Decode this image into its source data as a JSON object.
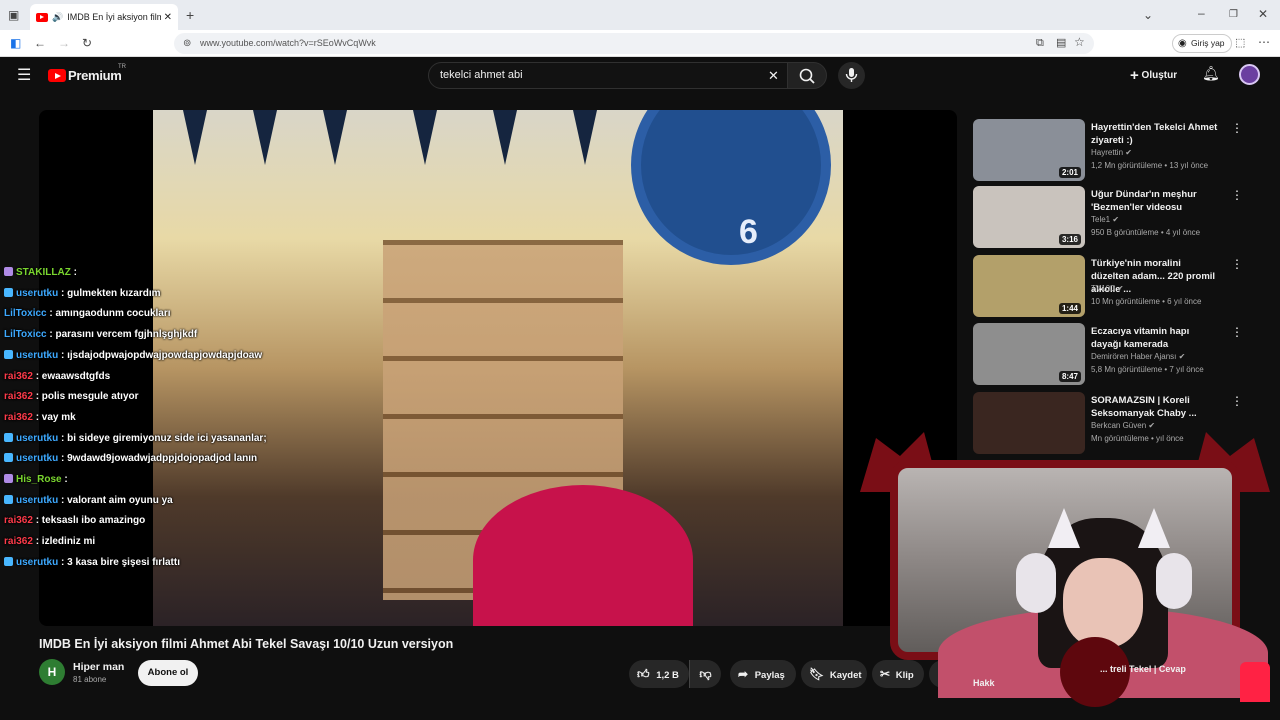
{
  "browser": {
    "tab_title": "IMDB En İyi aksiyon filmi Ah",
    "url": "www.youtube.com/watch?v=rSEoWvCqWvk",
    "signin_label": "Giriş yap"
  },
  "header": {
    "logo_text": "Premium",
    "logo_region": "TR",
    "search_value": "tekelci ahmet abi",
    "create_label": "Oluştur"
  },
  "chat": [
    {
      "user": "STAKILLAZ",
      "text": ":",
      "user_color": "green",
      "badge": "purple"
    },
    {
      "user": "userutku",
      "text": ": gulmekten kızardım",
      "user_color": "blue",
      "badge": "blue"
    },
    {
      "user": "LilToxicc",
      "text": ": amıngaodunm cocukları",
      "user_color": "blue",
      "badge": ""
    },
    {
      "user": "LilToxicc",
      "text": ": parasını vercem fgjhnlşghjkdf",
      "user_color": "blue",
      "badge": ""
    },
    {
      "user": "userutku",
      "text": ": ıjsdajodpwajopdwajpowdapjowdapjdoaw",
      "user_color": "blue",
      "badge": "blue"
    },
    {
      "user": "rai362",
      "text": ": ewaawsdtgfds",
      "user_color": "red",
      "badge": ""
    },
    {
      "user": "rai362",
      "text": ": polis mesgule atıyor",
      "user_color": "red",
      "badge": ""
    },
    {
      "user": "rai362",
      "text": ": vay mk",
      "user_color": "red",
      "badge": ""
    },
    {
      "user": "userutku",
      "text": ": bi sideye giremiyonuz side ici yasananlar;",
      "user_color": "blue",
      "badge": "blue"
    },
    {
      "user": "userutku",
      "text": ": 9wdawd9jowadwjadppjdojopadjod lanın",
      "user_color": "blue",
      "badge": "blue"
    },
    {
      "user": "His_Rose",
      "text": ":",
      "user_color": "green",
      "badge": "purple"
    },
    {
      "user": "userutku",
      "text": ": valorant aim oyunu ya",
      "user_color": "blue",
      "badge": "blue"
    },
    {
      "user": "rai362",
      "text": ": teksaslı ibo amazingo",
      "user_color": "red",
      "badge": ""
    },
    {
      "user": "rai362",
      "text": ": izlediniz mi",
      "user_color": "red",
      "badge": ""
    },
    {
      "user": "userutku",
      "text": ": 3 kasa bire şişesi fırlattı",
      "user_color": "blue",
      "badge": "blue"
    }
  ],
  "video": {
    "title": "IMDB En İyi aksiyon filmi Ahmet Abi Tekel Savaşı 10/10 Uzun versiyon",
    "clock_number": "6",
    "channel_initial": "H",
    "channel_name": "Hiper man",
    "subscribers": "81 abone",
    "subscribe_label": "Abone ol",
    "like_count": "1,2 B",
    "share_label": "Paylaş",
    "save_label": "Kaydet",
    "clip_label": "Klip",
    "more_label": "•••"
  },
  "recommendations": [
    {
      "title": "Hayrettin'den Tekelci Ahmet ziyareti :)",
      "channel": "Hayrettin",
      "meta": "1,2 Mn görüntüleme • 13 yıl önce",
      "duration": "2:01",
      "thumb": "#8a8f98"
    },
    {
      "title": "Uğur Dündar'ın meşhur 'Bezmen'ler videosu",
      "channel": "Tele1",
      "meta": "950 B görüntüleme • 4 yıl önce",
      "duration": "3:16",
      "thumb": "#c9c3bd"
    },
    {
      "title": "Türkiye'nin moralini düzelten adam... 220 promil alkolle ...",
      "channel": "TV100",
      "meta": "10 Mn görüntüleme • 6 yıl önce",
      "duration": "1:44",
      "thumb": "#b3a06a"
    },
    {
      "title": "Eczacıya vitamin hapı dayağı kamerada",
      "channel": "Demirören Haber Ajansı",
      "meta": "5,8 Mn görüntüleme • 7 yıl önce",
      "duration": "8:47",
      "thumb": "#8e8e8e"
    },
    {
      "title": "SORAMAZSIN | Koreli Seksomanyak Chaby ...",
      "channel": "Berkcan Güven",
      "meta": "Mn görüntüleme • yıl önce",
      "duration": "",
      "thumb": "#3a2620"
    }
  ],
  "overlay": {
    "partial_title_1": "... treli Tekel | Cevap",
    "partial_title_2": "Hakk"
  }
}
